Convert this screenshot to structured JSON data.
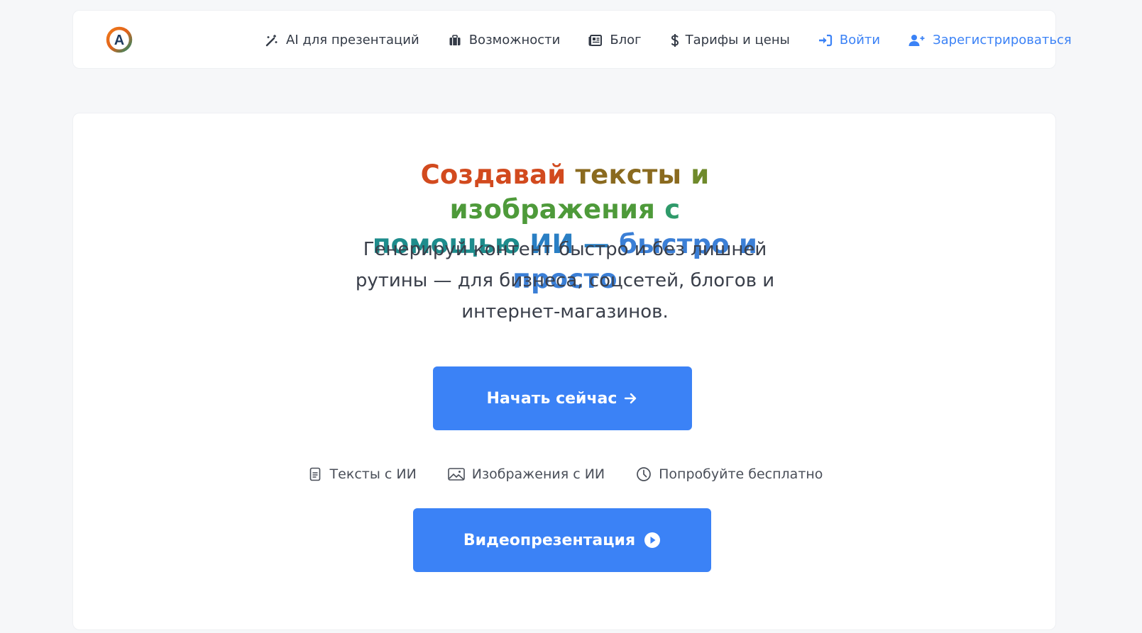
{
  "nav": {
    "logo_letter": "A",
    "items": [
      {
        "label": "AI для презентаций",
        "icon": "magic-wand-icon"
      },
      {
        "label": "Возможности",
        "icon": "briefcase-icon"
      },
      {
        "label": "Блог",
        "icon": "newspaper-icon"
      },
      {
        "label": "Тарифы и цены",
        "icon": "dollar-icon"
      },
      {
        "label": "Войти",
        "icon": "sign-in-icon"
      },
      {
        "label": "Зарегистрироваться",
        "icon": "user-plus-icon"
      }
    ]
  },
  "hero": {
    "headline_parts": [
      "Создавай",
      "тексты",
      "и",
      "изображения",
      "с",
      "помощью",
      "ИИ",
      "—",
      "быстро",
      "и",
      "просто"
    ],
    "headline_colors": [
      "#d24a1e",
      "#8a6a1f",
      "#6f8a2b",
      "#4e9a3a",
      "#2f9a6a",
      "#1e8c8c",
      "#2a7fc4",
      "#2a7fc4",
      "#3b7fd6",
      "#3b7fd6",
      "#3b7fd6"
    ],
    "subtitle": "Генерируй контент быстро и без лишней рутины — для бизнеса, соцсетей, блогов и интернет-магазинов.",
    "primary_button": "Начать сейчас",
    "features": [
      {
        "label": "Тексты с ИИ",
        "icon": "document-icon"
      },
      {
        "label": "Изображения с ИИ",
        "icon": "image-icon"
      },
      {
        "label": "Попробуйте бесплатно",
        "icon": "clock-icon"
      }
    ],
    "video_button": "Видеопрезентация"
  },
  "colors": {
    "accent": "#3b82f6",
    "page_bg": "#f6f7f9",
    "text": "#333a46"
  }
}
